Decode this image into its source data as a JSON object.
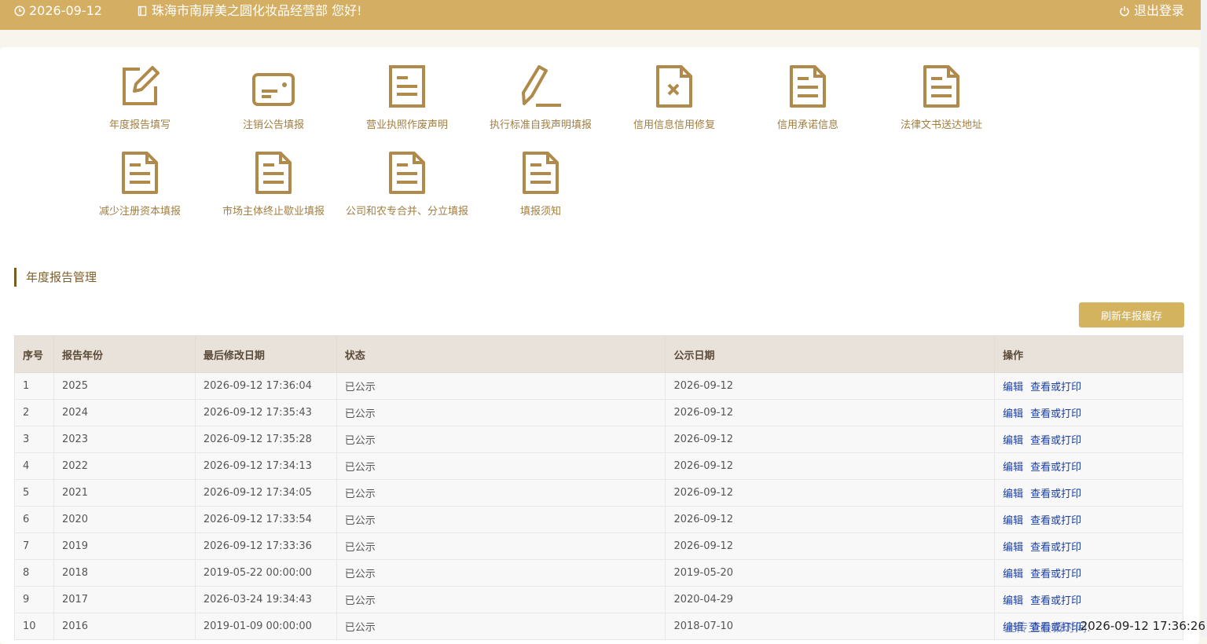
{
  "topbar": {
    "date": "2026-09-12",
    "greeting": "珠海市南屏美之圆化妆品经营部 您好!",
    "logout": "退出登录"
  },
  "icons": {
    "clock": "clock-icon",
    "user": "card-icon",
    "power": "power-icon"
  },
  "tiles": [
    {
      "label": "年度报告填写",
      "icon": "edit-square-icon"
    },
    {
      "label": "注销公告填报",
      "icon": "id-card-icon"
    },
    {
      "label": "营业执照作废声明",
      "icon": "document-icon"
    },
    {
      "label": "执行标准自我声明填报",
      "icon": "pencil-icon"
    },
    {
      "label": "信用信息信用修复",
      "icon": "document-x-icon"
    },
    {
      "label": "信用承诺信息",
      "icon": "document-icon"
    },
    {
      "label": "法律文书送达地址",
      "icon": "document-icon"
    },
    {
      "label": "减少注册资本填报",
      "icon": "document-icon"
    },
    {
      "label": "市场主体终止歇业填报",
      "icon": "document-icon"
    },
    {
      "label": "公司和农专合并、分立填报",
      "icon": "document-icon"
    },
    {
      "label": "填报须知",
      "icon": "document-icon"
    }
  ],
  "section": {
    "title": "年度报告管理",
    "refresh_label": "刷新年报缓存"
  },
  "table": {
    "headers": [
      "序号",
      "报告年份",
      "最后修改日期",
      "状态",
      "公示日期",
      "操作"
    ],
    "edit_label": "编辑",
    "view_label": "查看或打印",
    "rows": [
      [
        "1",
        "2025",
        "2026-09-12 17:36:04",
        "已公示",
        "2026-09-12"
      ],
      [
        "2",
        "2024",
        "2026-09-12 17:35:43",
        "已公示",
        "2026-09-12"
      ],
      [
        "3",
        "2023",
        "2026-09-12 17:35:28",
        "已公示",
        "2026-09-12"
      ],
      [
        "4",
        "2022",
        "2026-09-12 17:34:13",
        "已公示",
        "2026-09-12"
      ],
      [
        "5",
        "2021",
        "2026-09-12 17:34:05",
        "已公示",
        "2026-09-12"
      ],
      [
        "6",
        "2020",
        "2026-09-12 17:33:54",
        "已公示",
        "2026-09-12"
      ],
      [
        "7",
        "2019",
        "2026-09-12 17:33:36",
        "已公示",
        "2026-09-12"
      ],
      [
        "8",
        "2018",
        "2019-05-22 00:00:00",
        "已公示",
        "2019-05-20"
      ],
      [
        "9",
        "2017",
        "2026-03-24 19:34:43",
        "已公示",
        "2020-04-29"
      ],
      [
        "10",
        "2016",
        "2019-01-09 00:00:00",
        "已公示",
        "2018-07-10"
      ]
    ]
  },
  "overlay": {
    "timestamp": "2026-09-12 17:36:26",
    "ghost": "上传至最新时间:"
  },
  "colors": {
    "brand": "#d4ae62",
    "icon": "#b08a4a",
    "link": "#1a3ea3"
  }
}
